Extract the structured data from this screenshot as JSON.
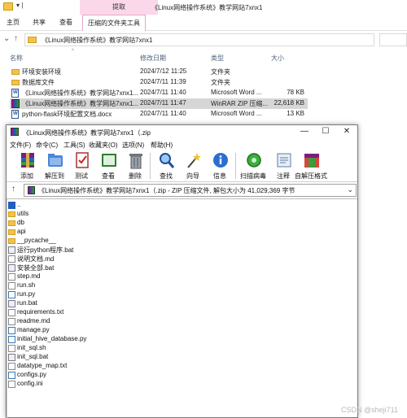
{
  "explorer": {
    "ribbon_context_tab": "提取",
    "window_title": "《Linux网络操作系统》教学网站7xnx1",
    "tabs": [
      "主页",
      "共享",
      "查看",
      "压缩的文件夹工具"
    ],
    "address": "《Linux网络操作系统》教学网站7xnx1",
    "columns": {
      "name": "名称",
      "date": "修改日期",
      "type": "类型",
      "size": "大小"
    },
    "files": [
      {
        "name": "环境安装环境",
        "date": "2024/7/12 11:25",
        "type": "文件夹",
        "size": "",
        "icon": "folder-icon"
      },
      {
        "name": "数据库文件",
        "date": "2024/7/11 11:39",
        "type": "文件夹",
        "size": "",
        "icon": "folder-icon"
      },
      {
        "name": "《Linux网络操作系统》教学网站7xnx1...",
        "date": "2024/7/11 11:40",
        "type": "Microsoft Word ...",
        "size": "78 KB",
        "icon": "word-doc-icon"
      },
      {
        "name": "《Linux网络操作系统》教学网站7xnx1...",
        "date": "2024/7/11 11:47",
        "type": "WinRAR ZIP 压缩...",
        "size": "22,618 KB",
        "icon": "zip-archive-icon"
      },
      {
        "name": "python-flask环境配置文档.docx",
        "date": "2024/7/11 11:40",
        "type": "Microsoft Word ...",
        "size": "13 KB",
        "icon": "word-doc-icon"
      }
    ]
  },
  "rar": {
    "title": "《Linux网络操作系统》教学网站7xnx1（.zip",
    "menu": [
      "文件(F)",
      "命令(C)",
      "工具(S)",
      "收藏夹(O)",
      "选项(N)",
      "帮助(H)"
    ],
    "tools": [
      {
        "label": "添加",
        "icon": "add-archive-icon"
      },
      {
        "label": "解压到",
        "icon": "extract-to-icon"
      },
      {
        "label": "测试",
        "icon": "test-icon"
      },
      {
        "label": "查看",
        "icon": "view-icon"
      },
      {
        "label": "删除",
        "icon": "delete-icon"
      },
      {
        "label": "查找",
        "icon": "find-icon"
      },
      {
        "label": "向导",
        "icon": "wizard-icon"
      },
      {
        "label": "信息",
        "icon": "info-icon"
      },
      {
        "label": "扫描病毒",
        "icon": "virus-scan-icon"
      },
      {
        "label": "注释",
        "icon": "comment-icon"
      },
      {
        "label": "自解压格式",
        "icon": "sfx-icon"
      }
    ],
    "path": "《Linux网络操作系统》教学网站7xnx1（.zip - ZIP 压缩文件, 解包大小为 41,029,369 字节",
    "items": [
      {
        "name": "..",
        "icon": "up-icon"
      },
      {
        "name": "utils",
        "icon": "folder-icon"
      },
      {
        "name": "db",
        "icon": "folder-icon"
      },
      {
        "name": "api",
        "icon": "folder-icon"
      },
      {
        "name": "__pycache__",
        "icon": "folder-icon"
      },
      {
        "name": "运行python程序.bat",
        "icon": "bat-file-icon"
      },
      {
        "name": "说明文档.md",
        "icon": "file-icon"
      },
      {
        "name": "安装全部.bat",
        "icon": "bat-file-icon"
      },
      {
        "name": "step.md",
        "icon": "file-icon"
      },
      {
        "name": "run.sh",
        "icon": "file-icon"
      },
      {
        "name": "run.py",
        "icon": "py-file-icon"
      },
      {
        "name": "run.bat",
        "icon": "bat-file-icon"
      },
      {
        "name": "requirements.txt",
        "icon": "file-icon"
      },
      {
        "name": "readme.md",
        "icon": "file-icon"
      },
      {
        "name": "manage.py",
        "icon": "py-file-icon"
      },
      {
        "name": "initial_hive_database.py",
        "icon": "py-file-icon"
      },
      {
        "name": "init_sql.sh",
        "icon": "file-icon"
      },
      {
        "name": "init_sql.bat",
        "icon": "bat-file-icon"
      },
      {
        "name": "datatype_map.txt",
        "icon": "file-icon"
      },
      {
        "name": "configs.py",
        "icon": "py-file-icon"
      },
      {
        "name": "config.ini",
        "icon": "file-icon"
      }
    ]
  },
  "watermark": "CSDN @sheji711"
}
